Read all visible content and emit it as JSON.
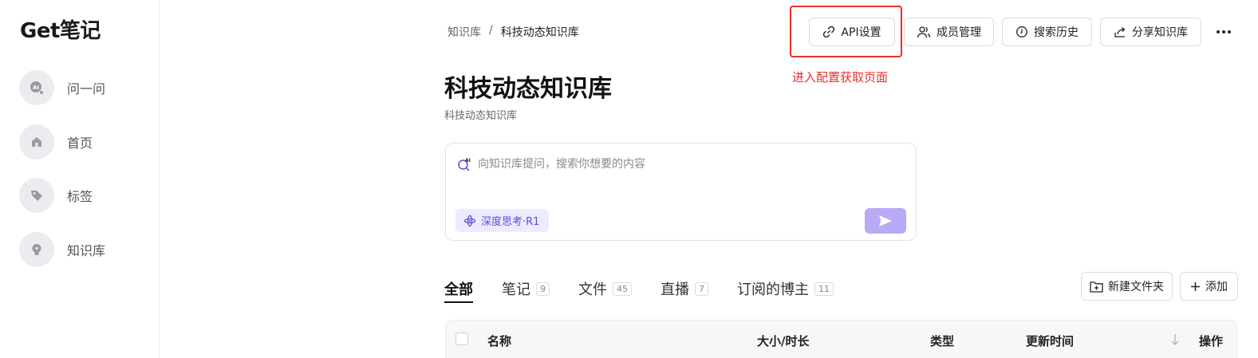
{
  "app": {
    "logo": "Get笔记"
  },
  "sidebar": {
    "items": [
      {
        "label": "问一问",
        "icon": "ai-chat-icon"
      },
      {
        "label": "首页",
        "icon": "home-icon"
      },
      {
        "label": "标签",
        "icon": "tag-icon"
      },
      {
        "label": "知识库",
        "icon": "lightbulb-icon"
      }
    ]
  },
  "breadcrumb": {
    "root": "知识库",
    "separator": "/",
    "current": "科技动态知识库"
  },
  "toolbar": {
    "api_settings": "API设置",
    "members": "成员管理",
    "search_history": "搜索历史",
    "share": "分享知识库"
  },
  "annotation": {
    "text": "进入配置获取页面",
    "color": "#e8302c"
  },
  "page": {
    "title": "科技动态知识库",
    "subtitle": "科技动态知识库"
  },
  "ask": {
    "placeholder": "向知识库提问，搜索你想要的内容",
    "mode_chip": "深度思考·R1"
  },
  "tabs": [
    {
      "label": "全部",
      "count": "",
      "active": true
    },
    {
      "label": "笔记",
      "count": "9"
    },
    {
      "label": "文件",
      "count": "45"
    },
    {
      "label": "直播",
      "count": "7"
    },
    {
      "label": "订阅的博主",
      "count": "11"
    }
  ],
  "actions": {
    "new_folder": "新建文件夹",
    "add": "添加"
  },
  "table": {
    "columns": [
      "名称",
      "大小/时长",
      "类型",
      "更新时间",
      "操作"
    ]
  },
  "colors": {
    "accent": "#5b4fd8",
    "send_button": "#b9a9f7",
    "highlight": "#e8302c"
  }
}
